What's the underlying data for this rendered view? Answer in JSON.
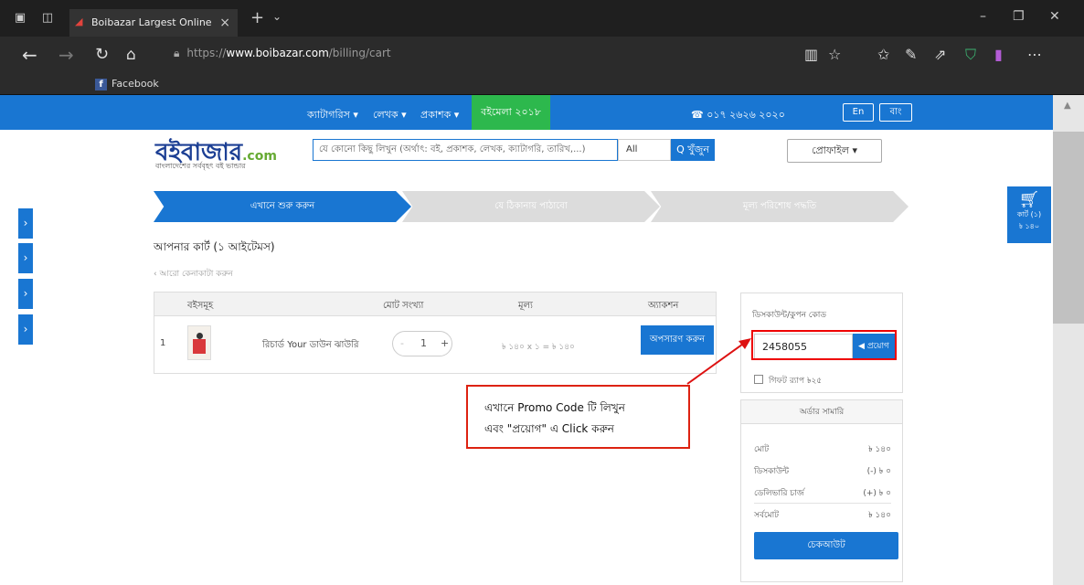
{
  "browser": {
    "tab_title": "Boibazar Largest Online",
    "url_prefix": "https://",
    "url_domain": "www.boibazar.com",
    "url_path": "/billing/cart",
    "favorite": "Facebook"
  },
  "site": {
    "menu": [
      "ক্যাটাগরিস ▾",
      "লেখক ▾",
      "প্রকাশক ▾"
    ],
    "boimela": "বইমেলা ২০১৮",
    "phone": "☎ ০১৭ ২৬২৬ ২০২০",
    "lang_en": "En",
    "lang_bn": "বাং",
    "logo": "বইবাজার",
    "logo_com": ".com",
    "logo_tagline": "বাংলাদেশের সর্ববৃহৎ বই ভান্ডার",
    "search_placeholder": "যে কোনো কিছু লিখুন (অর্থাৎ: বই, প্রকাশক, লেখক, ক্যাটাগরি, তারিখ,...)",
    "search_category": "All",
    "search_button": "Q খুঁজুন",
    "profile_button": "প্রোফাইল ▾",
    "floating_cart_label": "কার্ট (১)",
    "floating_cart_total": "৳ ১৪০"
  },
  "steps": [
    "এখানে শুরু করুন",
    "যে ঠিকানায় পাঠাবো",
    "মূল্য পরিশোধ পদ্ধতি"
  ],
  "cart": {
    "title": "আপনার কার্ট (১ আইটেমস)",
    "continue_link": "‹ আরো কেনাকাটা করুন",
    "headers": [
      "বইসমূহ",
      "মোট সংখ্যা",
      "মূল্য",
      "অ্যাকশন"
    ],
    "rows": [
      {
        "index": "1",
        "name": "রিচার্ড Your ডাউন ঝাউরি",
        "qty": "1",
        "price": "৳ ১৪০ x ১ = ৳ ১৪০",
        "remove": "অপসারণ করুন"
      }
    ]
  },
  "coupon": {
    "title": "ডিসকাউন্ট/কুপন কোড",
    "value": "2458055",
    "apply": "◀ প্রয়োগ",
    "gift": "গিফট র‍্যাপ ৳২৫"
  },
  "summary": {
    "title": "অর্ডার সামারি",
    "rows": [
      {
        "label": "মোট",
        "value": "৳ ১৪০"
      },
      {
        "label": "ডিসকাউন্ট",
        "value": "(-) ৳ ০"
      },
      {
        "label": "ডেলিভারি চার্জ",
        "value": "(+) ৳ ০"
      },
      {
        "label": "সর্বমোট",
        "value": "৳ ১৪০"
      }
    ],
    "checkout": "চেকআউট"
  },
  "annotation": {
    "line1": "এখানে Promo Code টি লিখুন",
    "line2": "এবং \"প্রয়োগ\" এ Click করুন",
    "color": "#dd1111"
  }
}
